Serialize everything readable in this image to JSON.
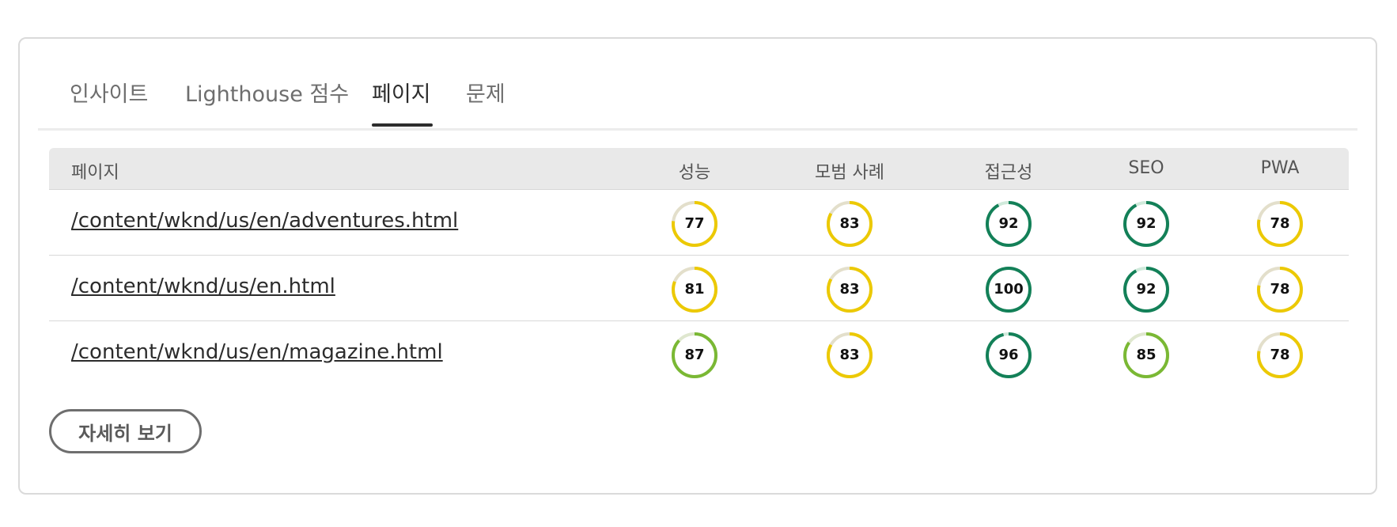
{
  "tabs": [
    {
      "label": "인사이트"
    },
    {
      "label": "Lighthouse 점수"
    },
    {
      "label": "페이지"
    },
    {
      "label": "문제"
    }
  ],
  "active_tab": "페이지",
  "table": {
    "headers": [
      "페이지",
      "성능",
      "모범 사례",
      "접근성",
      "SEO",
      "PWA"
    ],
    "rows": [
      {
        "url": "/content/wknd/us/en/adventures.html",
        "scores": [
          77,
          83,
          92,
          92,
          78
        ]
      },
      {
        "url": "/content/wknd/us/en.html",
        "scores": [
          81,
          83,
          100,
          92,
          78
        ]
      },
      {
        "url": "/content/wknd/us/en/magazine.html",
        "scores": [
          87,
          83,
          96,
          85,
          78
        ]
      }
    ]
  },
  "button": {
    "label": "자세히 보기"
  },
  "colors": {
    "gauge_dark_green": "#138058",
    "gauge_light_green": "#7ab834",
    "gauge_yellow": "#ecc903",
    "gauge_track_green": "#d0eadb",
    "gauge_track_yellow": "#e3dfcb",
    "gauge_track_light_green": "#dfe7cf"
  }
}
